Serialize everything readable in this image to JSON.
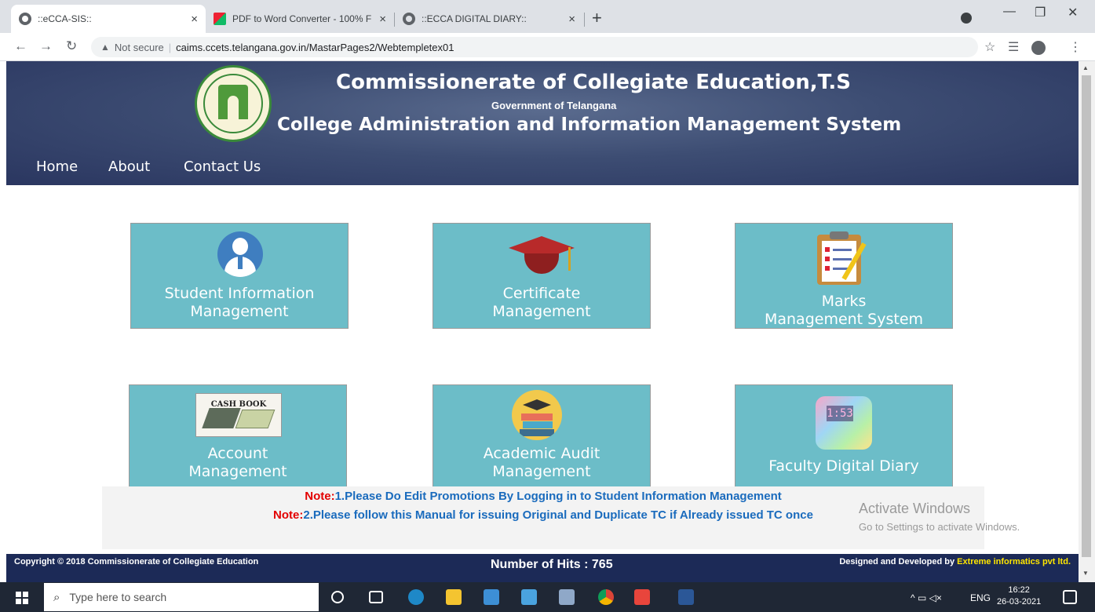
{
  "browser": {
    "tabs": [
      {
        "title": "::eCCA-SIS::",
        "close": "×"
      },
      {
        "title": "PDF to Word Converter - 100% F",
        "close": "×"
      },
      {
        "title": "::ECCA DIGITAL DIARY::",
        "close": "×"
      }
    ],
    "new_tab": "+",
    "security": "Not secure",
    "url": "caims.ccets.telangana.gov.in/MastarPages2/Webtempletex01"
  },
  "header": {
    "title": "Commissionerate of Collegiate Education,T.S",
    "subtitle": "Government of Telangana",
    "system": "College Administration and Information Management System"
  },
  "nav": {
    "home": "Home",
    "about": "About",
    "contact": "Contact Us"
  },
  "tiles": [
    {
      "l1": "Student Information",
      "l2": "Management"
    },
    {
      "l1": "Certificate",
      "l2": "Management"
    },
    {
      "l1": "Marks",
      "l2": "Management System"
    },
    {
      "l1": "Account",
      "l2": "Management",
      "icon_text": "CASH BOOK"
    },
    {
      "l1": "Academic Audit",
      "l2": "Management"
    },
    {
      "l1": "Faculty Digital Diary",
      "icon_text": "1:53"
    }
  ],
  "notes": {
    "n1_lead": "Note:",
    "n1_text": "1.Please Do Edit Promotions By Logging in to Student Information Management",
    "n2_lead": "Note:",
    "n2_text": "2.Please follow this Manual for issuing Original and Duplicate TC if Already issued TC once"
  },
  "watermark": {
    "line1": "Activate Windows",
    "line2": "Go to Settings to activate Windows."
  },
  "footer": {
    "copyright": "Copyright © 2018 Commissionerate of Collegiate Education",
    "hits": "Number of Hits : 765",
    "designed": "Designed and Developed by",
    "company": "Extreme informatics pvt ltd."
  },
  "taskbar": {
    "search_placeholder": "Type here to search",
    "lang": "ENG",
    "time": "16:22",
    "date": "26-03-2021"
  }
}
